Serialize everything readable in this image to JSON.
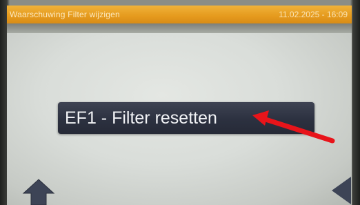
{
  "status_bar": {
    "title": "Waarschuwing Filter wijzigen",
    "datetime": "11.02.2025 - 16:09"
  },
  "main": {
    "reset_button_label": "EF1 - Filter resetten"
  },
  "icons": {
    "home": "home-arrow-up-icon",
    "back": "triangle-left-icon",
    "annotation": "red-arrow-annotation"
  },
  "colors": {
    "status_bar": "#e59a1d",
    "button": "#2c3140",
    "annotation": "#e8141a"
  }
}
